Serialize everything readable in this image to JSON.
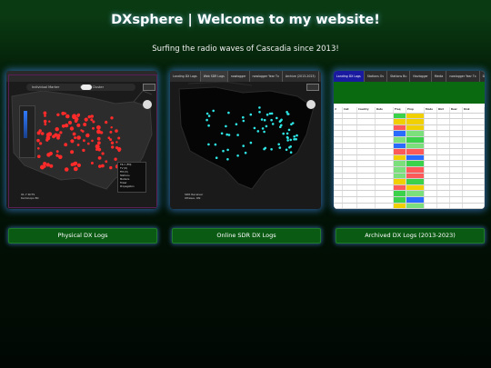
{
  "header": {
    "title": "DXsphere | Welcome to my website!",
    "subtitle": "Surfing the radio waves of Cascadia since 2013!"
  },
  "colors": {
    "background": "#041e08",
    "button_bg": "#0b5a14",
    "glow": "#4696ff",
    "physical_dot": "#ff2a2a",
    "sdr_dot": "#2ee6e6"
  },
  "cards": [
    {
      "button_label": "Physical DX Logs",
      "thumbnail": {
        "toggle_left": "Individual Marker",
        "toggle_right": "Marker Cluster",
        "legend": [
          "TR-1 (FM)",
          "TV (D)",
          "FM (D)",
          "Stations",
          "Markers",
          "Tower",
          "Propagation"
        ],
        "footer_line1": "91.7 KCTS",
        "footer_line2": "Kamloops BC"
      }
    },
    {
      "button_label": "Online SDR DX Logs",
      "thumbnail": {
        "tabs": [
          "Landing DX Logs",
          "Web SDR Logs",
          "nowlogger",
          "nowlogger Year Tx",
          "Archive (2013-2023)",
          "Details"
        ],
        "footer_line1": "SDR Receiver",
        "footer_line2": "Ottawa, ON"
      }
    },
    {
      "button_label": "Archived DX Logs (2013-2023)",
      "thumbnail": {
        "tabs": [
          "Landing DX Logs",
          "Stations Ov",
          "Stations Bu",
          "Navlogger",
          "Media",
          "nowlogger Year Tx",
          "Details"
        ],
        "columns": [
          "#",
          "Call",
          "Country",
          "Date",
          "Freq",
          "Prop",
          "Mode",
          "Dist",
          "Bear",
          "Rmk"
        ]
      }
    }
  ]
}
